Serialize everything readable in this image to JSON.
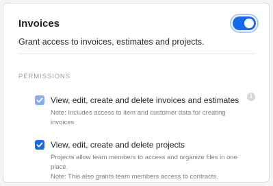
{
  "header": {
    "title": "Invoices",
    "toggle": {
      "state": "on"
    },
    "subtitle": "Grant access to invoices, estimates and projects."
  },
  "permissions": {
    "section_label": "PERMISSIONS",
    "items": [
      {
        "label": "View, edit, create and delete invoices and estimates",
        "note_line1": "Note: Includes access to item and customer data for creating",
        "note_line2": "invoices",
        "checked": true,
        "disabled": true,
        "info_icon": "i"
      },
      {
        "label": "View, edit, create and delete projects",
        "note_line1": "Projects allow team members to access and organize files in one place.",
        "note_line2": "Note: This also grants team members access to contracts.",
        "checked": true,
        "disabled": false
      }
    ]
  },
  "colors": {
    "accent": "#1669e8",
    "accent_disabled": "#85aef0",
    "muted_text": "#7a8087"
  }
}
